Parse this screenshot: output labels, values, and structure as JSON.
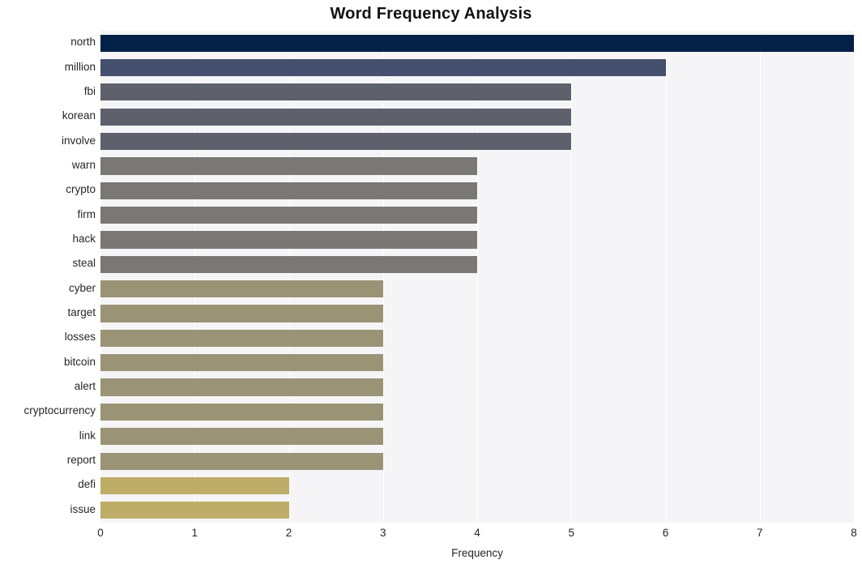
{
  "chart_data": {
    "type": "bar",
    "orientation": "horizontal",
    "title": "Word Frequency Analysis",
    "xlabel": "Frequency",
    "ylabel": "",
    "categories": [
      "north",
      "million",
      "fbi",
      "korean",
      "involve",
      "warn",
      "crypto",
      "firm",
      "hack",
      "steal",
      "cyber",
      "target",
      "losses",
      "bitcoin",
      "alert",
      "cryptocurrency",
      "link",
      "report",
      "defi",
      "issue"
    ],
    "values": [
      8,
      6,
      5,
      5,
      5,
      4,
      4,
      4,
      4,
      4,
      3,
      3,
      3,
      3,
      3,
      3,
      3,
      3,
      2,
      2
    ],
    "xlim": [
      0,
      8
    ],
    "xticks": [
      "0",
      "1",
      "2",
      "3",
      "4",
      "5",
      "6",
      "7",
      "8"
    ],
    "xtick_values": [
      0,
      1,
      2,
      3,
      4,
      5,
      6,
      7,
      8
    ],
    "grid": true,
    "grid_axis": "x",
    "legend": false,
    "bar_colors": [
      "#032147",
      "#454f6e",
      "#5e616c",
      "#5e616c",
      "#5e616c",
      "#7a7874",
      "#7a7874",
      "#7a7874",
      "#7a7874",
      "#7a7874",
      "#9b9375",
      "#9b9375",
      "#9b9375",
      "#9b9375",
      "#9b9375",
      "#9b9375",
      "#9b9375",
      "#9b9375",
      "#bdad68",
      "#bdad68"
    ],
    "plot_background": "#f5f5f7",
    "gridline_color": "#ffffff",
    "figure_background": "#ffffff",
    "text_color": "#262626"
  }
}
